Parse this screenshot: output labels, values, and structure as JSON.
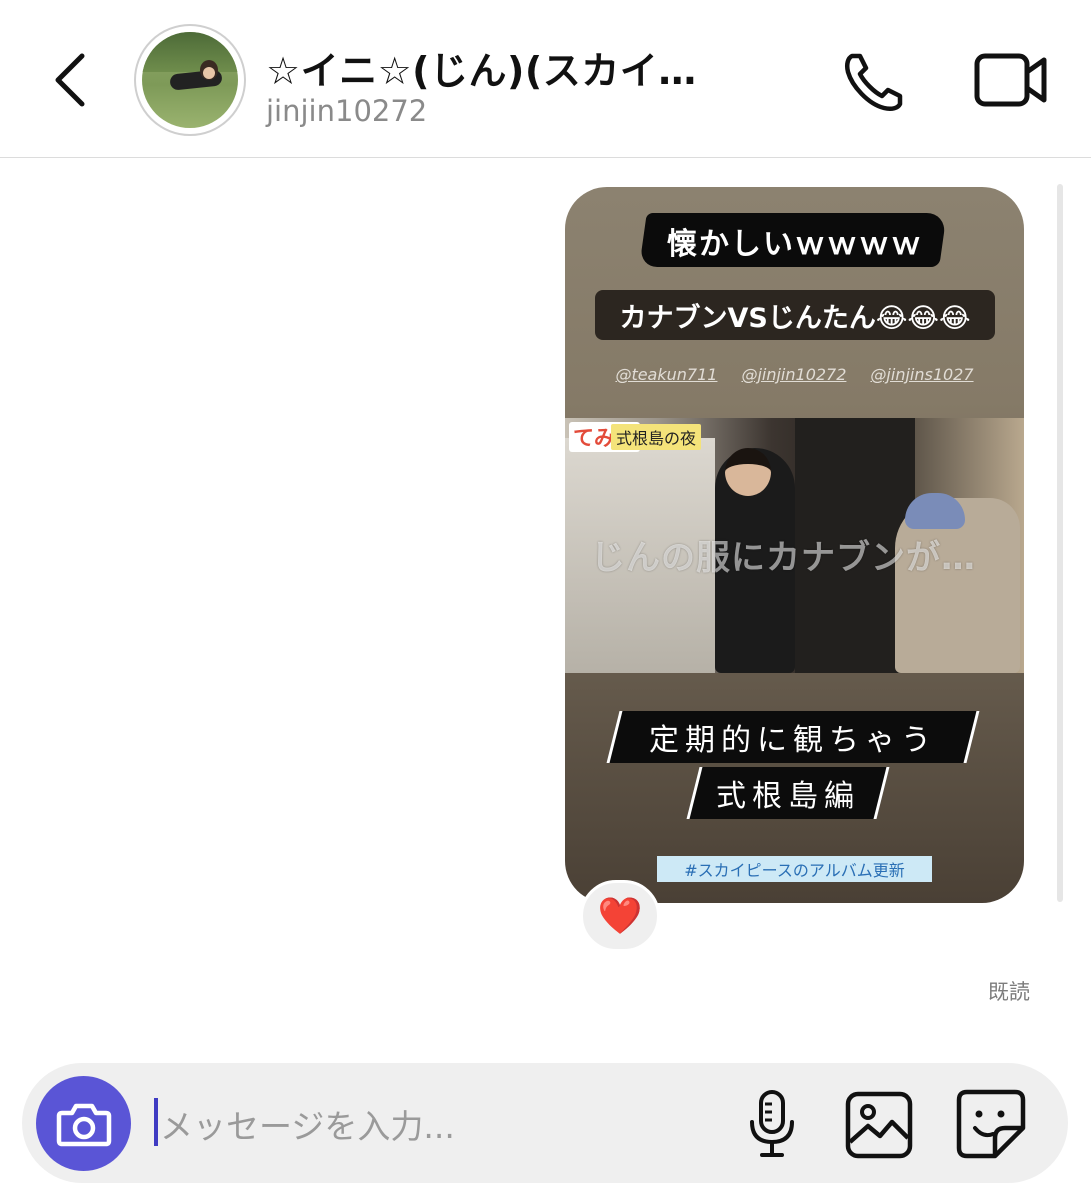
{
  "header": {
    "back_icon": "chevron-left-icon",
    "name": "☆イニ☆(じん)(スカイ…",
    "username": "jinjin10272",
    "call_icon": "phone-icon",
    "video_icon": "video-camera-icon"
  },
  "story": {
    "top_text": "懐かしいｗｗｗｗ",
    "pill_text": "カナブンVSじんたん😂😂😂",
    "handles": [
      "@teakun711",
      "@jinjin10272",
      "@jinjins1027"
    ],
    "video_tag_brand": "てみじ",
    "video_tag_title": "式根島の夜",
    "video_caption": "じんの服にカナブンが…",
    "banner_line1": "定期的に観ちゃう",
    "banner_line2": "式根島編",
    "hashtag": "#スカイピースのアルバム更新"
  },
  "reaction": {
    "emoji": "❤️"
  },
  "status": {
    "read": "既読"
  },
  "composer": {
    "camera_icon": "camera-icon",
    "placeholder": "メッセージを入力...",
    "mic_icon": "microphone-icon",
    "gallery_icon": "image-gallery-icon",
    "sticker_icon": "sticker-icon",
    "accent_color": "#5a55d6"
  }
}
